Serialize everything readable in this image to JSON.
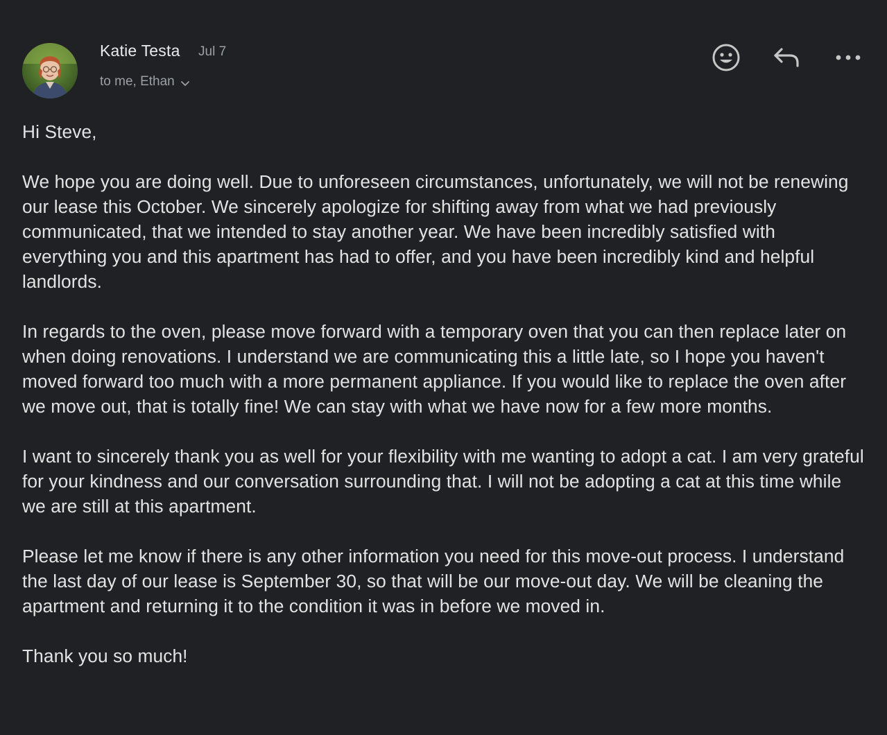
{
  "email": {
    "sender_name": "Katie Testa",
    "date": "Jul 7",
    "recipients": "to me, Ethan",
    "actions": {
      "emoji_icon": "smiley-face-icon",
      "reply_icon": "reply-arrow-icon",
      "more_icon": "more-horizontal-icon"
    },
    "body": {
      "greeting": "Hi Steve,",
      "paragraph_1": "We hope you are doing well. Due to unforeseen circumstances, unfortunately, we will not be renewing our lease this October. We sincerely apologize for shifting away from what we had previously communicated, that we intended to stay another year. We have been incredibly satisfied with everything you and this apartment has had to offer, and you have been incredibly kind and helpful landlords.",
      "paragraph_2": "In regards to the oven, please move forward with a temporary oven that you can then replace later on when doing renovations. I understand we are communicating this a little late, so I hope you haven't moved forward too much with a more permanent appliance. If you would like to replace the oven after we move out, that is totally fine! We can stay with what we have now for a few more months.",
      "paragraph_3": "I want to sincerely thank you as well for your flexibility with me wanting to adopt a cat. I am very grateful for your kindness and our conversation surrounding that. I will not be adopting a cat at this time while we are still at this apartment.",
      "paragraph_4": "Please let me know if there is any other information you need for this move-out process. I understand the last day of our lease is September 30, so that will be our move-out day. We will be cleaning the apartment and returning it to the condition it was in before we moved in.",
      "closing": "Thank you so much!"
    }
  },
  "colors": {
    "background": "#202124",
    "primary_text": "#e3e3e3",
    "secondary_text": "#9aa0a6",
    "icon": "#c4c7c5"
  }
}
